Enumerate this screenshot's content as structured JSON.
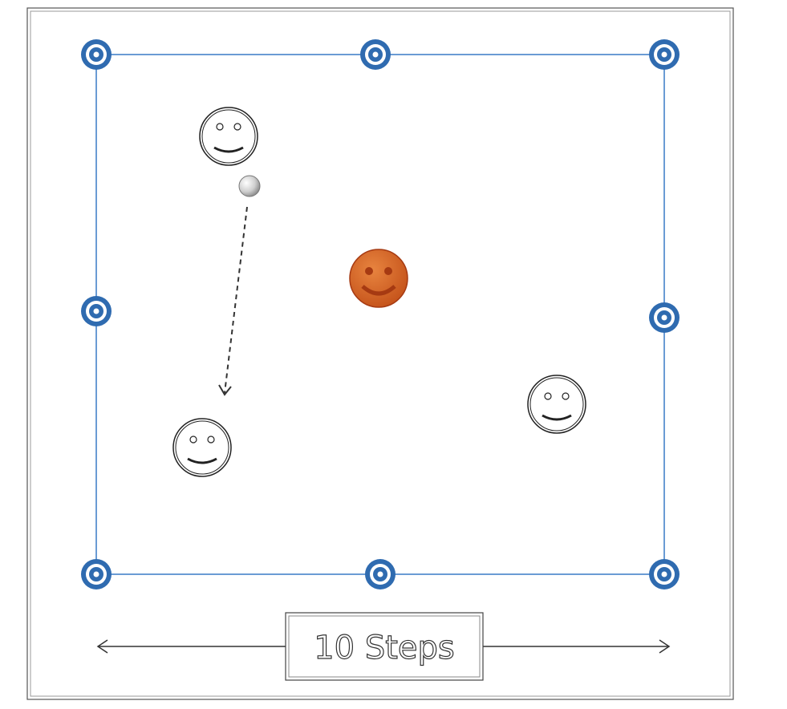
{
  "diagram": {
    "caption": "10 Steps",
    "colors": {
      "field_line": "#6a9bd4",
      "handle_outer": "#2f6bb0",
      "handle_inner": "#ffffff",
      "outer_frame": "#555555",
      "player_outline": "#222222",
      "center_player_fill": "#d4621f",
      "center_player_features": "#a63a12",
      "ball_fill": "#d6d6d6",
      "arrow": "#333333"
    },
    "icons": {
      "player": "smiley-face-icon",
      "center_player": "smiley-face-icon",
      "ball": "ball-icon",
      "handle": "resize-handle-icon"
    }
  }
}
